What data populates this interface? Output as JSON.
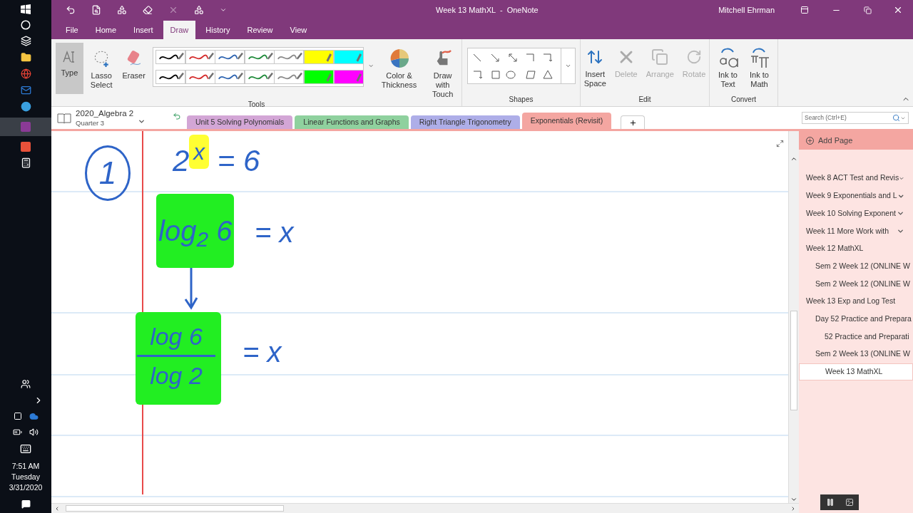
{
  "window": {
    "title": "Week 13 MathXL  -  OneNote",
    "user": "Mitchell Ehrman"
  },
  "ribbon_tabs": [
    {
      "label": "File",
      "selected": false
    },
    {
      "label": "Home",
      "selected": false
    },
    {
      "label": "Insert",
      "selected": false
    },
    {
      "label": "Draw",
      "selected": true
    },
    {
      "label": "History",
      "selected": false
    },
    {
      "label": "Review",
      "selected": false
    },
    {
      "label": "View",
      "selected": false
    }
  ],
  "tools": {
    "type": {
      "label": "Type",
      "selected": true
    },
    "lasso": "Lasso\nSelect",
    "eraser": "Eraser",
    "pens": [
      {
        "kind": "pen",
        "color": "#000000"
      },
      {
        "kind": "pen",
        "color": "#d42a2a"
      },
      {
        "kind": "pen",
        "color": "#2e64b0"
      },
      {
        "kind": "pen",
        "color": "#1f8a3a"
      },
      {
        "kind": "pen",
        "color": "#8a8a8a"
      },
      {
        "kind": "highlighter",
        "color": "#ffff00"
      },
      {
        "kind": "highlighter",
        "color": "#00ffff"
      },
      {
        "kind": "pen",
        "color": "#000000"
      },
      {
        "kind": "pen",
        "color": "#d42a2a"
      },
      {
        "kind": "pen",
        "color": "#2e64b0"
      },
      {
        "kind": "pen",
        "color": "#1f8a3a"
      },
      {
        "kind": "pen",
        "color": "#8a8a8a"
      },
      {
        "kind": "highlighter",
        "color": "#00ff00"
      },
      {
        "kind": "highlighter",
        "color": "#ff00ff"
      }
    ],
    "color_thickness": "Color &\nThickness",
    "draw_touch": "Draw with\nTouch",
    "group": "Tools"
  },
  "shapes": {
    "group": "Shapes"
  },
  "edit": {
    "buttons": [
      {
        "label": "Insert\nSpace",
        "disabled": false
      },
      {
        "label": "Delete",
        "disabled": true
      },
      {
        "label": "Arrange",
        "disabled": true
      },
      {
        "label": "Rotate",
        "disabled": true
      }
    ],
    "group": "Edit"
  },
  "convert": {
    "buttons": [
      "Ink to\nText",
      "Ink to\nMath"
    ],
    "group": "Convert"
  },
  "notebook": {
    "name": "2020_Algebra 2",
    "section_group": "Quarter 3"
  },
  "sections": [
    {
      "label": "Unit 5 Solving Polynomials",
      "color": "#d3a6d6",
      "selected": false
    },
    {
      "label": "Linear Functions and Graphs",
      "color": "#8fd19e",
      "selected": false
    },
    {
      "label": "Right Triangle Trigonometry",
      "color": "#aeaee8",
      "selected": false
    },
    {
      "label": "Exponentials (Revisit)",
      "color": "#f4a6a1",
      "selected": true
    }
  ],
  "search": {
    "placeholder": "Search (Ctrl+E)"
  },
  "pages": {
    "add_page": "Add Page",
    "items": [
      {
        "title": "Week 8 ACT Test and Revis",
        "collapsed": true,
        "selected": false
      },
      {
        "title": "Week 9 Exponentials and L",
        "collapsed": true,
        "selected": false
      },
      {
        "title": "Week 10 Solving Exponent",
        "collapsed": true,
        "selected": false
      },
      {
        "title": "Week 11 More Work with",
        "collapsed": true,
        "selected": false
      },
      {
        "title": "Week 12 MathXL",
        "collapsed": false,
        "selected": false,
        "children": [
          {
            "title": "Sem 2 Week 12 (ONLINE W",
            "selected": false
          },
          {
            "title": "Sem 2 Week 12 (ONLINE W",
            "selected": false
          }
        ]
      },
      {
        "title": "Week 13 Exp and Log Test",
        "collapsed": false,
        "selected": false,
        "children": [
          {
            "title": "Day 52 Practice and Prepara",
            "selected": false,
            "children": [
              {
                "title": "52 Practice and Preparati",
                "selected": false
              }
            ]
          },
          {
            "title": "Sem 2 Week 13 (ONLINE W",
            "selected": false,
            "children": [
              {
                "title": "Week 13 MathXL",
                "selected": true
              }
            ]
          }
        ]
      }
    ]
  },
  "ink": {
    "number": "1",
    "line1": "2$^{x}$ = 6",
    "line2": "log$_{2}$ 6",
    "line2_rhs": "= x",
    "numerator": "log 6",
    "denominator": "log 2",
    "line3_rhs": "= x"
  },
  "taskbar": {
    "time": "7:51 AM",
    "day": "Tuesday",
    "date": "3/31/2020"
  }
}
